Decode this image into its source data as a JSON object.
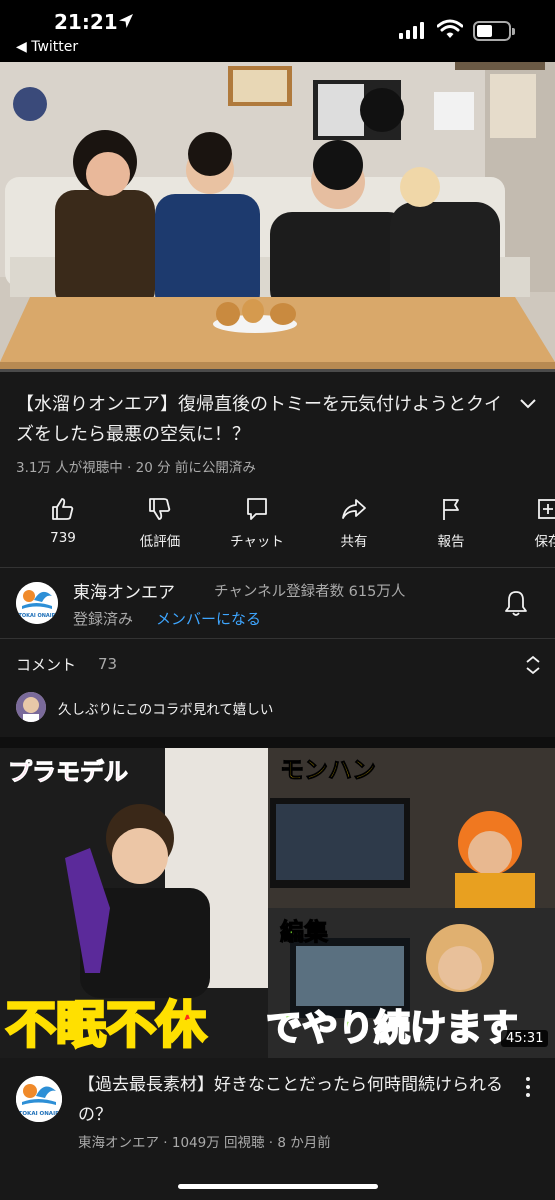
{
  "status_bar": {
    "time": "21:21",
    "back_app": "◀ Twitter"
  },
  "player": {
    "progress": 0.0
  },
  "video": {
    "title": "【水溜りオンエア】復帰直後のトミーを元気付けようとクイズをしたら最悪の空気に！？",
    "meta": "3.1万 人が視聴中 · 20 分 前に公開済み"
  },
  "actions": [
    {
      "label": "739",
      "icon": "like-icon"
    },
    {
      "label": "低評価",
      "icon": "dislike-icon"
    },
    {
      "label": "チャット",
      "icon": "chat-icon"
    },
    {
      "label": "共有",
      "icon": "share-icon"
    },
    {
      "label": "報告",
      "icon": "flag-icon"
    },
    {
      "label": "保存",
      "icon": "save-icon"
    }
  ],
  "channel": {
    "name": "東海オンエア",
    "subscribers": "チャンネル登録者数 615万人",
    "subscribed": "登録済み",
    "member": "メンバーになる",
    "avatar_text": "TOKAI ONAIR"
  },
  "comments": {
    "label": "コメント",
    "count": "73",
    "top_comment": "久しぶりにこのコラボ見れて嬉しい"
  },
  "recommended": {
    "thumb_texts": {
      "left_tag": "プラモデル",
      "right_top_tag": "モンハン",
      "right_mid_tag": "編集",
      "banner_red": "不眠不休",
      "banner_green": "でやり続けます"
    },
    "duration": "45:31",
    "title": "【過去最長素材】好きなことだったら何時間続けられるの？",
    "meta": "東海オンエア · 1049万 回視聴 · 8 か月前"
  },
  "colors": {
    "background": "#181818",
    "accent_blue": "#3ea6ff",
    "progress_red": "#e00000"
  }
}
